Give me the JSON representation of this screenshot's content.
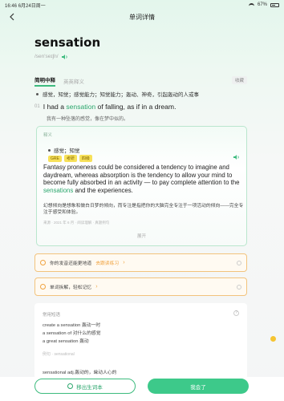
{
  "status": {
    "time": "16:46",
    "date": "6月24日周一",
    "battery": "67%"
  },
  "header": {
    "title": "单词详情"
  },
  "word": {
    "text": "sensation",
    "phonetic": "/sen'seɪʃn/",
    "tabs": [
      {
        "label": "简明中释"
      },
      {
        "label": "英英释义"
      }
    ],
    "tab_right": "收藏",
    "definition": "感觉，知觉；感觉能力；知觉能力；轰动、神奇，引起轰动的人或事"
  },
  "example": {
    "num": "01",
    "prefix": "I had a ",
    "highlight": "sensation",
    "suffix": " of falling, as if in a dream.",
    "translation": "我有一种坠落的感觉，像在梦中似的。"
  },
  "card": {
    "top_label": "释义",
    "sense": "感觉；知觉",
    "tags": [
      "GRE",
      "考研",
      "四级"
    ],
    "en_prefix": "Fantasy proneness could be considered a tendency to imagine and daydream, whereas absorption is the tendency to allow your mind to become fully absorbed in an activity — to pay complete attention to the ",
    "en_highlight": "sensations",
    "en_suffix": " and the experiences.",
    "zh": "幻想倾向是想象和做白日梦的倾向，而专注是指把你的大脑完全专注于一项活动的倾向——完全专注于感受和体验。",
    "meta": "来源 · 2021 年 6 月 · 阅读理解 · 真题例句",
    "more": "展开"
  },
  "banners": [
    {
      "text": "你的发音还能更地道",
      "link": "去跟读练习"
    },
    {
      "text": "单词拆解，轻松记忆"
    }
  ],
  "panel": {
    "head": "常用短语",
    "phrases": [
      "create a sensation 轰动一时",
      "a sensation of 对什么的感觉",
      "a great sensation 轰动"
    ],
    "sub": "例句 · sensational",
    "last": "sensational adj.轰动的，耸动人心的"
  },
  "buttons": {
    "add": "移出生词本",
    "know": "我会了"
  }
}
